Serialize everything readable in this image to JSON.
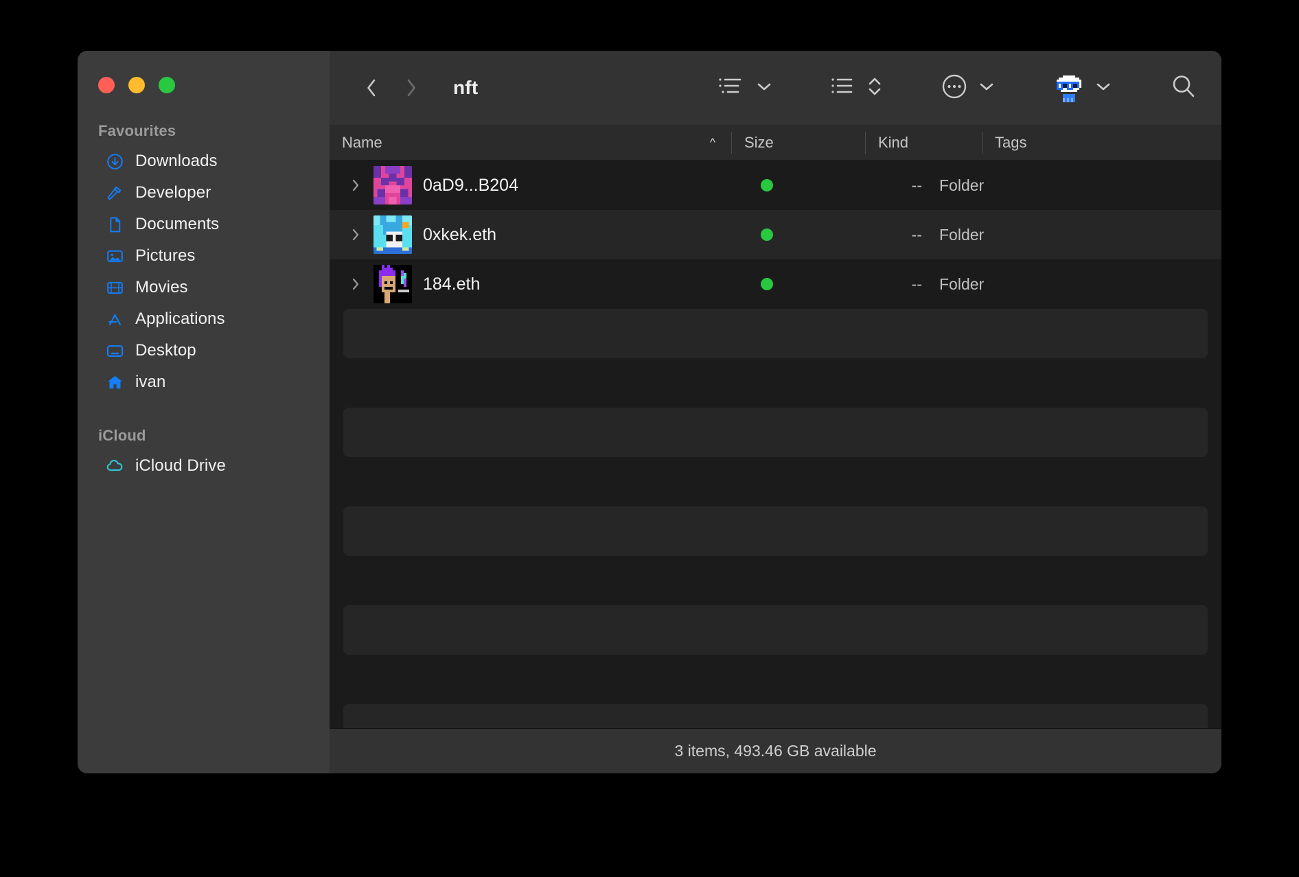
{
  "window": {
    "title": "nft",
    "traffic_lights": [
      {
        "name": "close",
        "color": "#ff5f57"
      },
      {
        "name": "minimize",
        "color": "#febc2e"
      },
      {
        "name": "maximize",
        "color": "#28c840"
      }
    ]
  },
  "sidebar": {
    "sections": [
      {
        "title": "Favourites",
        "items": [
          {
            "label": "Downloads",
            "icon": "download-circle-icon"
          },
          {
            "label": "Developer",
            "icon": "hammer-icon"
          },
          {
            "label": "Documents",
            "icon": "document-icon"
          },
          {
            "label": "Pictures",
            "icon": "photo-icon"
          },
          {
            "label": "Movies",
            "icon": "film-icon"
          },
          {
            "label": "Applications",
            "icon": "appstore-icon"
          },
          {
            "label": "Desktop",
            "icon": "desktop-icon"
          },
          {
            "label": "ivan",
            "icon": "home-icon"
          }
        ]
      },
      {
        "title": "iCloud",
        "items": [
          {
            "label": "iCloud Drive",
            "icon": "cloud-icon"
          }
        ]
      }
    ]
  },
  "toolbar": {
    "back_label": "Back",
    "forward_label": "Forward",
    "view_options_label": "View options",
    "group_sort_label": "Group and sort",
    "more_label": "More actions",
    "share_label": "Share",
    "search_label": "Search",
    "icons": [
      "chevron-left-icon",
      "chevron-right-icon",
      "list-view-icon",
      "chevron-down-icon",
      "group-list-icon",
      "chevron-up-down-icon",
      "ellipsis-circle-icon",
      "chevron-down-icon",
      "avatar-icon",
      "chevron-down-icon",
      "search-icon"
    ]
  },
  "file_table": {
    "columns": [
      {
        "key": "name",
        "label": "Name",
        "sorted": true,
        "sort_direction": "ascending",
        "sort_glyph": "^"
      },
      {
        "key": "size",
        "label": "Size"
      },
      {
        "key": "kind",
        "label": "Kind"
      },
      {
        "key": "tags",
        "label": "Tags"
      }
    ],
    "rows": [
      {
        "name": "0aD9...B204",
        "size": "--",
        "kind": "Folder",
        "tag_color": "#28c840",
        "thumbnail": "pixel-art-pink-purple",
        "expandable": true
      },
      {
        "name": "0xkek.eth",
        "size": "--",
        "kind": "Folder",
        "tag_color": "#28c840",
        "thumbnail": "pixel-art-blue-cat",
        "expandable": true
      },
      {
        "name": "184.eth",
        "size": "--",
        "kind": "Folder",
        "tag_color": "#28c840",
        "thumbnail": "pixel-art-punk-purple-mohawk",
        "expandable": true
      }
    ]
  },
  "status": {
    "text": "3 items, 493.46 GB available"
  },
  "colors": {
    "accent_blue": "#147efb",
    "sidebar_bg": "#3c3c3c",
    "toolbar_bg": "#333333",
    "content_bg": "#1b1b1b",
    "stripe_bg": "#262626",
    "tag_green": "#28c840",
    "icloud_cyan": "#30c6d6"
  }
}
